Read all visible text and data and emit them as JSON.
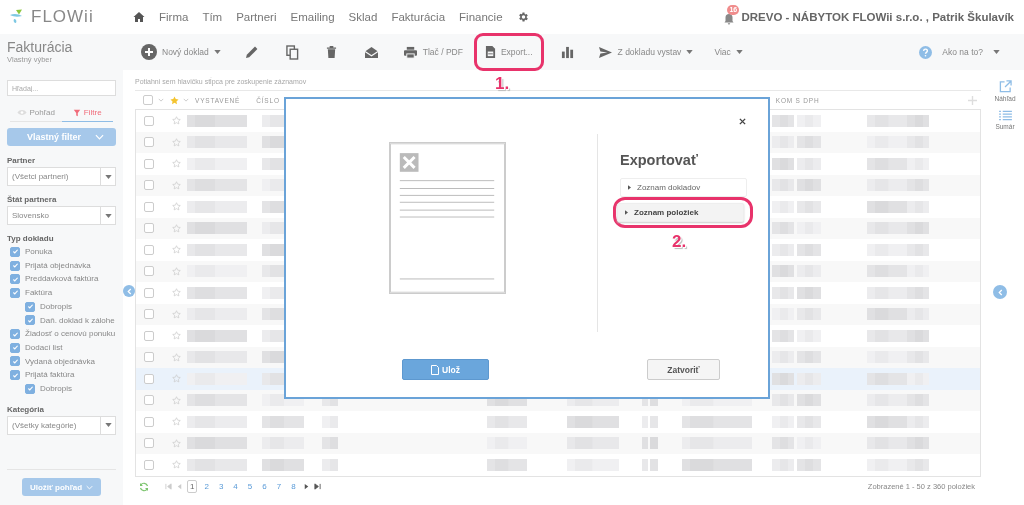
{
  "logo": {
    "text": "FLOWii"
  },
  "nav": {
    "items": [
      "Firma",
      "Tím",
      "Partneri",
      "Emailing",
      "Sklad",
      "Fakturácia",
      "Financie"
    ]
  },
  "notifications": {
    "count": "16"
  },
  "account": {
    "label": "DREVO - NÁBYTOK FLOWii s.r.o. , Patrik Škulavík"
  },
  "page": {
    "title": "Fakturácia",
    "subtitle": "Vlastný výber"
  },
  "toolbar": {
    "items": [
      {
        "kind": "text",
        "label": "Nový doklad",
        "dropdown": true
      },
      {
        "kind": "icon"
      },
      {
        "kind": "icon"
      },
      {
        "kind": "icon"
      },
      {
        "kind": "icon"
      },
      {
        "kind": "text",
        "label": "Tlač / PDF"
      },
      {
        "kind": "text",
        "label": "Export...",
        "annotation": "1."
      },
      {
        "kind": "icon"
      },
      {
        "kind": "text",
        "label": "Z dokladu vystav",
        "dropdown": true
      },
      {
        "kind": "text",
        "label": "Viac",
        "dropdown": true
      }
    ],
    "help": {
      "label": "Ako na to?"
    }
  },
  "sidebar": {
    "search": {
      "placeholder": "Hľadaj..."
    },
    "tabs": [
      {
        "label": "Pohľad",
        "selected": false
      },
      {
        "label": "Filtre",
        "selected": true
      }
    ],
    "filter_button": "Vlastný filter",
    "filters": [
      {
        "label": "Partner",
        "value": "(Všetci partneri)"
      },
      {
        "label": "Štát partnera",
        "value": "Slovensko"
      }
    ],
    "doc_types": {
      "label": "Typ dokladu",
      "items": [
        {
          "label": "Ponuka",
          "checked": true
        },
        {
          "label": "Prijatá objednávka",
          "checked": true
        },
        {
          "label": "Preddavková faktúra",
          "checked": true
        },
        {
          "label": "Faktúra",
          "checked": true,
          "children": [
            {
              "label": "Dobropis",
              "checked": true
            },
            {
              "label": "Daň. doklad k zálohe",
              "checked": true
            }
          ]
        },
        {
          "label": "Žiadosť o cenovú ponuku",
          "checked": true
        },
        {
          "label": "Dodací list",
          "checked": true
        },
        {
          "label": "Vydaná objednávka",
          "checked": true
        },
        {
          "label": "Prijatá faktúra",
          "checked": true,
          "children": [
            {
              "label": "Dobropis",
              "checked": true
            }
          ]
        }
      ]
    },
    "category": {
      "label": "Kategória",
      "value": "(Všetky kategórie)"
    },
    "save_button": "Uložiť pohľad"
  },
  "grid": {
    "group_hint": "Potiahni sem hlavičku stĺpca pre zoskupenie záznamov",
    "header_checkbox": {
      "checked": false
    },
    "columns": [
      "VYSTAVENÉ",
      "ČÍSLO",
      "KOM S DPH"
    ],
    "rows": [
      {
        "selected": false,
        "checked": false,
        "starred": false
      },
      {
        "selected": false,
        "checked": false,
        "starred": false
      },
      {
        "selected": false,
        "checked": false,
        "starred": false
      },
      {
        "selected": false,
        "checked": false,
        "starred": false
      },
      {
        "selected": false,
        "checked": false,
        "starred": false
      },
      {
        "selected": false,
        "checked": false,
        "starred": false
      },
      {
        "selected": false,
        "checked": false,
        "starred": false
      },
      {
        "selected": false,
        "checked": false,
        "starred": false
      },
      {
        "selected": false,
        "checked": false,
        "starred": false
      },
      {
        "selected": false,
        "checked": false,
        "starred": false
      },
      {
        "selected": false,
        "checked": false,
        "starred": false
      },
      {
        "selected": false,
        "checked": false,
        "starred": false
      },
      {
        "selected": true,
        "checked": false,
        "starred": false
      },
      {
        "selected": false,
        "checked": false,
        "starred": false
      },
      {
        "selected": false,
        "checked": false,
        "starred": false
      },
      {
        "selected": false,
        "checked": false,
        "starred": false
      },
      {
        "selected": false,
        "checked": false,
        "starred": false
      }
    ],
    "pagination": {
      "pages": [
        {
          "label": "1",
          "selected": true
        },
        {
          "label": "2",
          "selected": false
        },
        {
          "label": "3",
          "selected": false
        },
        {
          "label": "4",
          "selected": false
        },
        {
          "label": "5",
          "selected": false
        },
        {
          "label": "6",
          "selected": false
        },
        {
          "label": "7",
          "selected": false
        },
        {
          "label": "8",
          "selected": false
        }
      ],
      "summary": "Zobrazené 1 - 50 z 360 položiek"
    }
  },
  "rail": {
    "items": [
      {
        "label": "Náhľad"
      },
      {
        "label": "Sumár"
      }
    ]
  },
  "modal": {
    "title": "Exportovať",
    "options": [
      {
        "label": "Zoznam dokladov",
        "selected": false
      },
      {
        "label": "Zoznam položiek",
        "selected": true,
        "annotation": "2."
      }
    ],
    "buttons": [
      {
        "label": "Ulož",
        "kind": "primary"
      },
      {
        "label": "Zatvoriť",
        "kind": "secondary"
      }
    ]
  }
}
